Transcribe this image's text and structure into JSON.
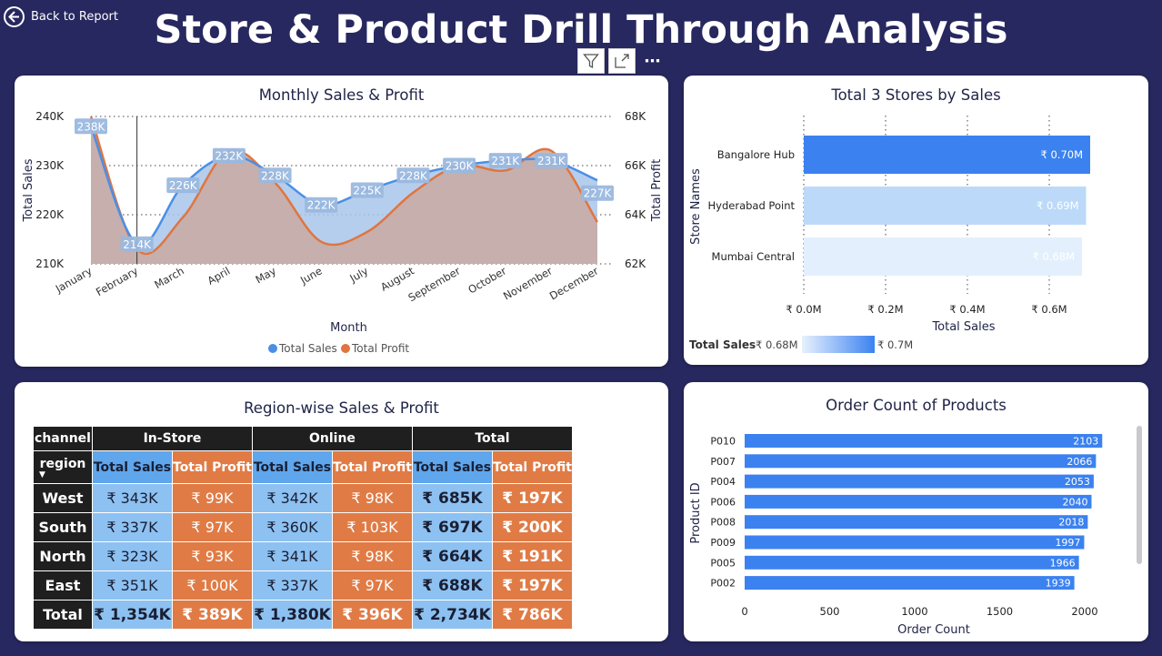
{
  "header": {
    "back_label": "Back to Report",
    "title": "Store & Product Drill Through Analysis"
  },
  "panels": {
    "monthly": {
      "title": "Monthly Sales & Profit"
    },
    "stores": {
      "title": "Total 3 Stores by Sales"
    },
    "region": {
      "title": "Region-wise Sales & Profit"
    },
    "products": {
      "title": "Order Count of Products"
    }
  },
  "chart_data": [
    {
      "type": "area",
      "title": "Monthly Sales & Profit",
      "xlabel": "Month",
      "ylabel": "Total Sales",
      "y2label": "Total Profit",
      "categories": [
        "January",
        "February",
        "March",
        "April",
        "May",
        "June",
        "July",
        "August",
        "September",
        "October",
        "November",
        "December"
      ],
      "ylim": [
        210,
        240
      ],
      "y2lim": [
        62,
        68
      ],
      "y_ticks": [
        "210K",
        "220K",
        "230K",
        "240K"
      ],
      "y2_ticks": [
        "62K",
        "64K",
        "66K",
        "68K"
      ],
      "series": [
        {
          "name": "Total Sales",
          "color": "#4a8fe6",
          "values": [
            238,
            214,
            226,
            232,
            228,
            222,
            225,
            228,
            230,
            231,
            231,
            227
          ],
          "labels": [
            "238K",
            "214K",
            "226K",
            "232K",
            "228K",
            "222K",
            "225K",
            "228K",
            "230K",
            "231K",
            "231K",
            "227K"
          ]
        },
        {
          "name": "Total Profit",
          "color": "#e0753f",
          "values": [
            68.0,
            62.6,
            63.9,
            66.6,
            65.3,
            62.9,
            63.3,
            64.9,
            66.0,
            65.8,
            66.6,
            63.7
          ]
        }
      ],
      "legend": "bottom",
      "grid": true
    },
    {
      "type": "bar",
      "orientation": "horizontal",
      "title": "Total 3 Stores by Sales",
      "xlabel": "Total Sales",
      "ylabel": "Store Names",
      "categories": [
        "Bangalore Hub",
        "Hyderabad Point",
        "Mumbai Central"
      ],
      "values": [
        0.7,
        0.69,
        0.68
      ],
      "labels": [
        "₹ 0.70M",
        "₹ 0.69M",
        "₹ 0.68M"
      ],
      "colors": [
        "#3b82f0",
        "#bcd9f9",
        "#e3effc"
      ],
      "xlim": [
        0,
        0.7
      ],
      "x_ticks": [
        "₹ 0.0M",
        "₹ 0.2M",
        "₹ 0.4M",
        "₹ 0.6M"
      ],
      "x_tick_values": [
        0,
        0.2,
        0.4,
        0.6
      ],
      "legend": {
        "label": "Total Sales",
        "min": "₹ 0.68M",
        "max": "₹ 0.7M"
      }
    },
    {
      "type": "table",
      "title": "Region-wise Sales & Profit",
      "corner_top": "channel",
      "corner_bottom": "region",
      "groups": [
        "In-Store",
        "Online",
        "Total"
      ],
      "subheaders": [
        "Total Sales",
        "Total Profit"
      ],
      "rows": [
        {
          "region": "West",
          "cells": [
            "₹ 343K",
            "₹ 99K",
            "₹ 342K",
            "₹ 98K",
            "₹ 685K",
            "₹ 197K"
          ]
        },
        {
          "region": "South",
          "cells": [
            "₹ 337K",
            "₹ 97K",
            "₹ 360K",
            "₹ 103K",
            "₹ 697K",
            "₹ 200K"
          ]
        },
        {
          "region": "North",
          "cells": [
            "₹ 323K",
            "₹ 93K",
            "₹ 341K",
            "₹ 98K",
            "₹ 664K",
            "₹ 191K"
          ]
        },
        {
          "region": "East",
          "cells": [
            "₹ 351K",
            "₹ 100K",
            "₹ 337K",
            "₹ 97K",
            "₹ 688K",
            "₹ 197K"
          ]
        }
      ],
      "total": {
        "region": "Total",
        "cells": [
          "₹ 1,354K",
          "₹ 389K",
          "₹ 1,380K",
          "₹ 396K",
          "₹ 2,734K",
          "₹ 786K"
        ]
      }
    },
    {
      "type": "bar",
      "orientation": "horizontal",
      "title": "Order Count of Products",
      "xlabel": "Order Count",
      "ylabel": "Product ID",
      "categories": [
        "P010",
        "P007",
        "P004",
        "P006",
        "P008",
        "P009",
        "P005",
        "P002"
      ],
      "values": [
        2103,
        2066,
        2053,
        2040,
        2018,
        1997,
        1966,
        1939
      ],
      "color": "#3b82f0",
      "xlim": [
        0,
        2200
      ],
      "x_ticks": [
        0,
        500,
        1000,
        1500,
        2000
      ]
    }
  ]
}
